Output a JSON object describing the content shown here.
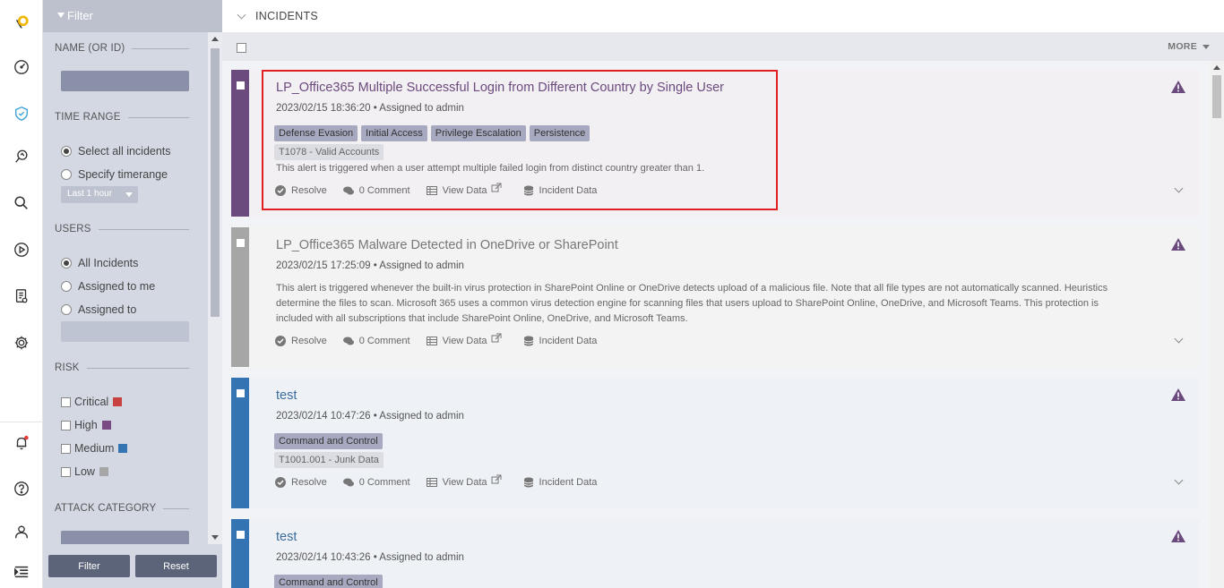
{
  "filter": {
    "header": "Filter",
    "name_section": "NAME (OR ID)",
    "time_section": "TIME RANGE",
    "time_all": "Select all incidents",
    "time_specify": "Specify timerange",
    "time_select": "Last 1 hour",
    "users_section": "USERS",
    "users_all": "All Incidents",
    "users_me": "Assigned to me",
    "users_to": "Assigned to",
    "risk_section": "RISK",
    "risk": [
      {
        "label": "Critical",
        "color": "#c94242"
      },
      {
        "label": "High",
        "color": "#7a4a82"
      },
      {
        "label": "Medium",
        "color": "#3574b3"
      },
      {
        "label": "Low",
        "color": "#a6a6a6"
      }
    ],
    "attack_section": "ATTACK CATEGORY",
    "filter_button": "Filter",
    "reset_button": "Reset"
  },
  "main": {
    "title": "INCIDENTS",
    "more": "MORE"
  },
  "labels": {
    "resolve": "Resolve",
    "view_data": "View Data",
    "incident_data": "Incident Data"
  },
  "incidents": [
    {
      "title": "LP_Office365 Multiple Successful Login from Different Country by Single User",
      "meta": "2023/02/15 18:36:20 • Assigned to admin",
      "tags": [
        "Defense Evasion",
        "Initial Access",
        "Privilege Escalation",
        "Persistence"
      ],
      "technique": "T1078 - Valid Accounts",
      "description": "This alert is triggered when a user attempt multiple failed login from distinct country greater than 1.",
      "comments": "0 Comment",
      "risk_color": "#6b4a7e",
      "title_color": "#6b4a7e"
    },
    {
      "title": "LP_Office365 Malware Detected in OneDrive or SharePoint",
      "meta": "2023/02/15 17:25:09 • Assigned to admin",
      "description_lines": [
        "This alert is triggered whenever the built-in virus protection in SharePoint Online or OneDrive detects upload of a malicious file. Note that all file types are not automatically scanned. Heuristics",
        "determine the files to scan. Microsoft 365 uses a common virus detection engine for scanning files that users upload to SharePoint Online, OneDrive, and Microsoft Teams. This protection is",
        "included with all subscriptions that include SharePoint Online, OneDrive, and Microsoft Teams."
      ],
      "comments": "0 Comment",
      "risk_color": "#a6a6a6",
      "title_color": "#777777"
    },
    {
      "title": "test",
      "meta": "2023/02/14 10:47:26 • Assigned to admin",
      "tags": [
        "Command and Control"
      ],
      "technique": "T1001.001 - Junk Data",
      "comments": "0 Comment",
      "risk_color": "#3574b3",
      "title_color": "#3b6c9c"
    },
    {
      "title": "test",
      "meta": "2023/02/14 10:43:26 • Assigned to admin",
      "tags": [
        "Command and Control"
      ],
      "risk_color": "#3574b3",
      "title_color": "#3b6c9c"
    }
  ],
  "colors": {
    "accent": "#3aa0d8",
    "highlight": "#e02020",
    "notification_dot": "#e53935"
  }
}
